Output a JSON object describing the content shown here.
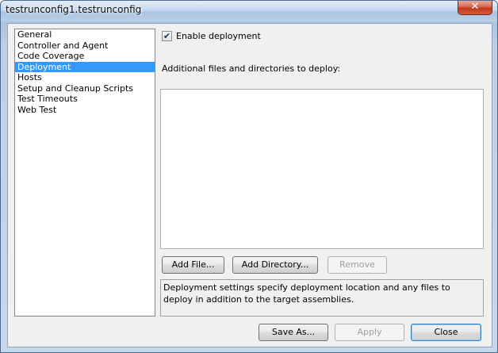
{
  "window": {
    "title": "testrunconfig1.testrunconfig",
    "close_glyph": "✕"
  },
  "nav": {
    "items": [
      {
        "label": "General",
        "selected": false
      },
      {
        "label": "Controller and Agent",
        "selected": false
      },
      {
        "label": "Code Coverage",
        "selected": false
      },
      {
        "label": "Deployment",
        "selected": true
      },
      {
        "label": "Hosts",
        "selected": false
      },
      {
        "label": "Setup and Cleanup Scripts",
        "selected": false
      },
      {
        "label": "Test Timeouts",
        "selected": false
      },
      {
        "label": "Web Test",
        "selected": false
      }
    ]
  },
  "deployment": {
    "enable_label": "Enable deployment",
    "enable_checked": true,
    "check_glyph": "✔",
    "additional_label": "Additional files and directories to deploy:",
    "add_file_label": "Add File...",
    "add_directory_label": "Add Directory...",
    "remove_label": "Remove",
    "description": "Deployment settings specify deployment location and any files to deploy in addition to the target assemblies."
  },
  "footer": {
    "save_as_label": "Save As...",
    "apply_label": "Apply",
    "close_label": "Close"
  },
  "colors": {
    "selection": "#3399ff",
    "window_frame": "#a9c2dd"
  }
}
